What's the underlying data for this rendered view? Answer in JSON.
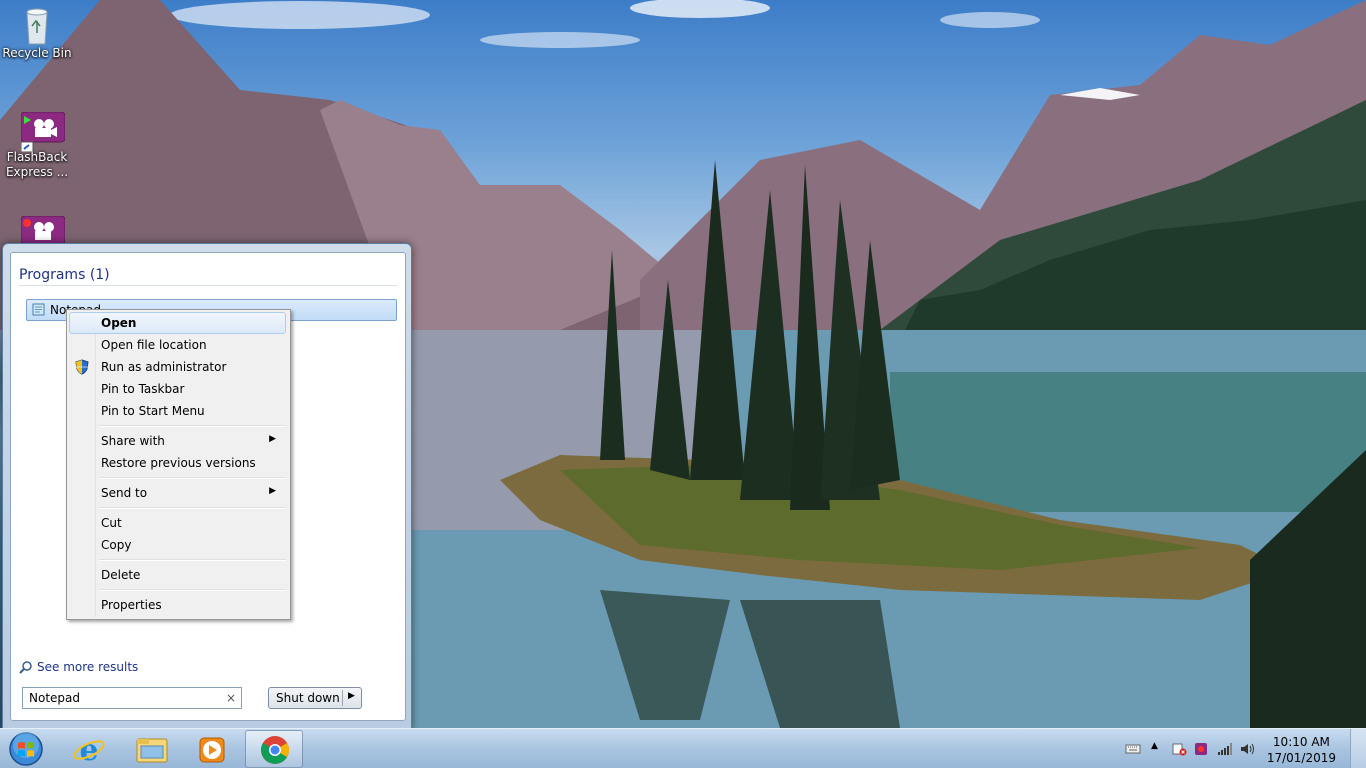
{
  "desktop": {
    "icons": [
      {
        "label": "Recycle Bin",
        "icon": "recycle-bin-icon"
      },
      {
        "label": "FlashBack Express ...",
        "icon": "flashback-express-icon"
      },
      {
        "label": "",
        "icon": "flashback-recorder-icon"
      }
    ]
  },
  "start_menu": {
    "programs_header": "Programs (1)",
    "results": [
      {
        "label": "Notepad",
        "icon": "notepad-icon"
      }
    ],
    "see_more": "See more results",
    "search": {
      "value": "Notepad",
      "clear": "×"
    },
    "shutdown": {
      "label": "Shut down",
      "arrow": "▶"
    }
  },
  "context_menu": {
    "items": [
      {
        "label": "Open"
      },
      {
        "label": "Open file location"
      },
      {
        "label": "Run as administrator",
        "icon": "uac-shield-icon"
      },
      {
        "label": "Pin to Taskbar"
      },
      {
        "label": "Pin to Start Menu"
      },
      {
        "label": "Share with",
        "submenu": "▶"
      },
      {
        "label": "Restore previous versions"
      },
      {
        "label": "Send to",
        "submenu": "▶"
      },
      {
        "label": "Cut"
      },
      {
        "label": "Copy"
      },
      {
        "label": "Delete"
      },
      {
        "label": "Properties"
      }
    ]
  },
  "taskbar": {
    "pinned": [
      "internet-explorer-icon",
      "windows-explorer-icon",
      "media-player-icon",
      "chrome-icon"
    ],
    "tray_expand": "▲",
    "clock": {
      "time": "10:10 AM",
      "date": "17/01/2019"
    }
  },
  "colors": {
    "link_blue": "#1e3287",
    "highlight_border": "#7da2ce",
    "taskbar": "#a9c4e0"
  }
}
